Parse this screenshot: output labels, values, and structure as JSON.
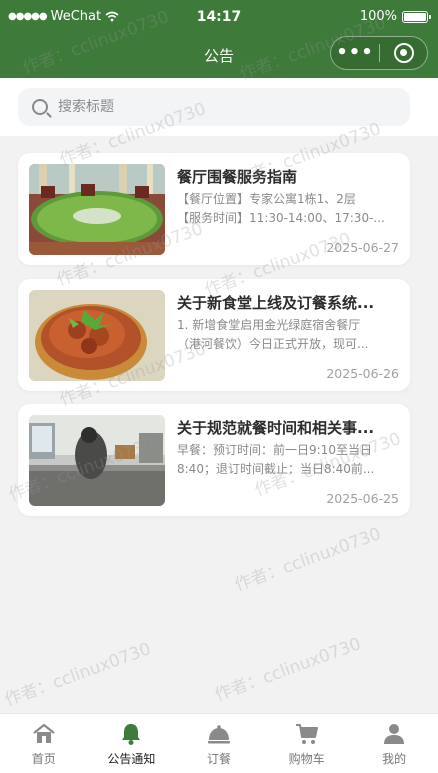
{
  "status_bar": {
    "carrier": "WeChat",
    "time": "14:17",
    "battery": "100%"
  },
  "nav": {
    "title": "公告",
    "more_icon": "more-dots-icon",
    "close_icon": "target-circle-icon"
  },
  "search": {
    "placeholder": "搜索标题",
    "icon": "search-icon"
  },
  "notices": [
    {
      "title": "餐厅围餐服务指南",
      "desc_lines": [
        "【餐厅位置】专家公寓1栋1、2层",
        "【服务时间】11:30-14:00、17:30-..."
      ],
      "date": "2025-06-27"
    },
    {
      "title": "关于新食堂上线及订餐系统...",
      "desc_lines": [
        "1. 新增食堂启用金光绿庭宿舍餐厅",
        "（港河餐饮）今日正式开放，现可..."
      ],
      "date": "2025-06-26"
    },
    {
      "title": "关于规范就餐时间和相关事...",
      "desc_lines": [
        "早餐：预订时间：前一日9:10至当日",
        "8:40；退订时间截止：当日8:40前..."
      ],
      "date": "2025-06-25"
    }
  ],
  "tabbar": [
    {
      "label": "首页",
      "icon": "home-icon",
      "active": false
    },
    {
      "label": "公告通知",
      "icon": "bell-icon",
      "active": true
    },
    {
      "label": "订餐",
      "icon": "cloche-icon",
      "active": false
    },
    {
      "label": "购物车",
      "icon": "cart-icon",
      "active": false
    },
    {
      "label": "我的",
      "icon": "user-icon",
      "active": false
    }
  ],
  "watermark": "作者：cclinux0730",
  "colors": {
    "brand_green": "#3e7a3a",
    "active_tab_green": "#3f7b3b",
    "inactive_icon": "#8a8a8a"
  }
}
